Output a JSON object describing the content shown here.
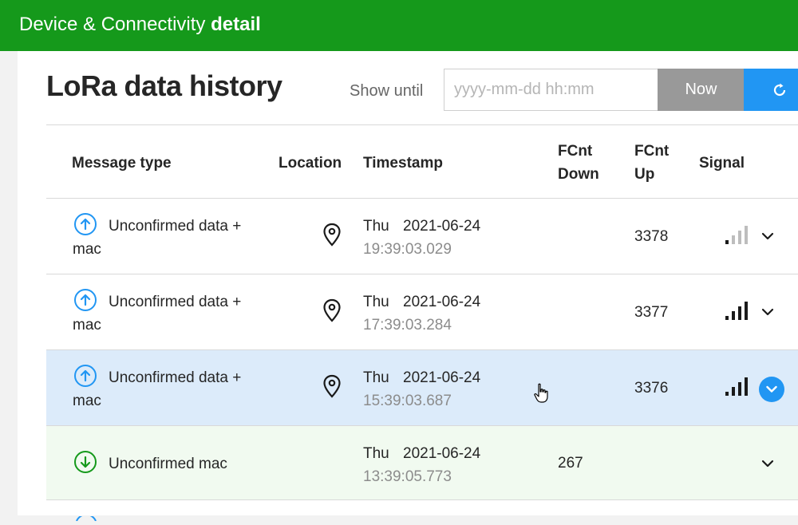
{
  "header": {
    "title_light": "Device & Connectivity",
    "title_bold": "detail"
  },
  "page": {
    "heading": "LoRa data history"
  },
  "filter": {
    "label": "Show until",
    "placeholder": "yyyy-mm-dd hh:mm",
    "now_label": "Now"
  },
  "table": {
    "columns": {
      "message_type": "Message type",
      "location": "Location",
      "timestamp": "Timestamp",
      "fcnt_down_1": "FCnt",
      "fcnt_down_2": "Down",
      "fcnt_up_1": "FCnt",
      "fcnt_up_2": "Up",
      "signal": "Signal"
    },
    "rows": [
      {
        "direction": "up",
        "message": "Unconfirmed data + mac",
        "has_location": true,
        "day": "Thu",
        "date": "2021-06-24",
        "time": "19:39:03.029",
        "fcnt_down": "",
        "fcnt_up": "3378",
        "signal_bars": 1,
        "signal_max": 4,
        "expanded_control": "chevron",
        "selected": false
      },
      {
        "direction": "up",
        "message": "Unconfirmed data + mac",
        "has_location": true,
        "day": "Thu",
        "date": "2021-06-24",
        "time": "17:39:03.284",
        "fcnt_down": "",
        "fcnt_up": "3377",
        "signal_bars": 4,
        "signal_max": 4,
        "expanded_control": "chevron",
        "selected": false
      },
      {
        "direction": "up",
        "message": "Unconfirmed data + mac",
        "has_location": true,
        "day": "Thu",
        "date": "2021-06-24",
        "time": "15:39:03.687",
        "fcnt_down": "",
        "fcnt_up": "3376",
        "signal_bars": 4,
        "signal_max": 4,
        "expanded_control": "chevron-circle",
        "selected": true
      },
      {
        "direction": "down",
        "message": "Unconfirmed mac",
        "has_location": false,
        "day": "Thu",
        "date": "2021-06-24",
        "time": "13:39:05.773",
        "fcnt_down": "267",
        "fcnt_up": "",
        "signal_bars": 0,
        "signal_max": 0,
        "expanded_control": "chevron",
        "selected": false
      }
    ]
  },
  "colors": {
    "brand_green": "#15991b",
    "accent_blue": "#2196f3",
    "uplink_icon": "#2196f3",
    "downlink_icon": "#15991b",
    "selected_row": "#dcebfa",
    "downlink_row": "#f1faf0"
  },
  "icons": {
    "uplink": "arrow-up-circle-icon",
    "downlink": "arrow-down-circle-icon",
    "location": "map-pin-icon",
    "signal": "signal-bars-icon",
    "expand": "chevron-down-icon",
    "refresh": "refresh-icon",
    "cursor": "hand-pointer-icon"
  }
}
